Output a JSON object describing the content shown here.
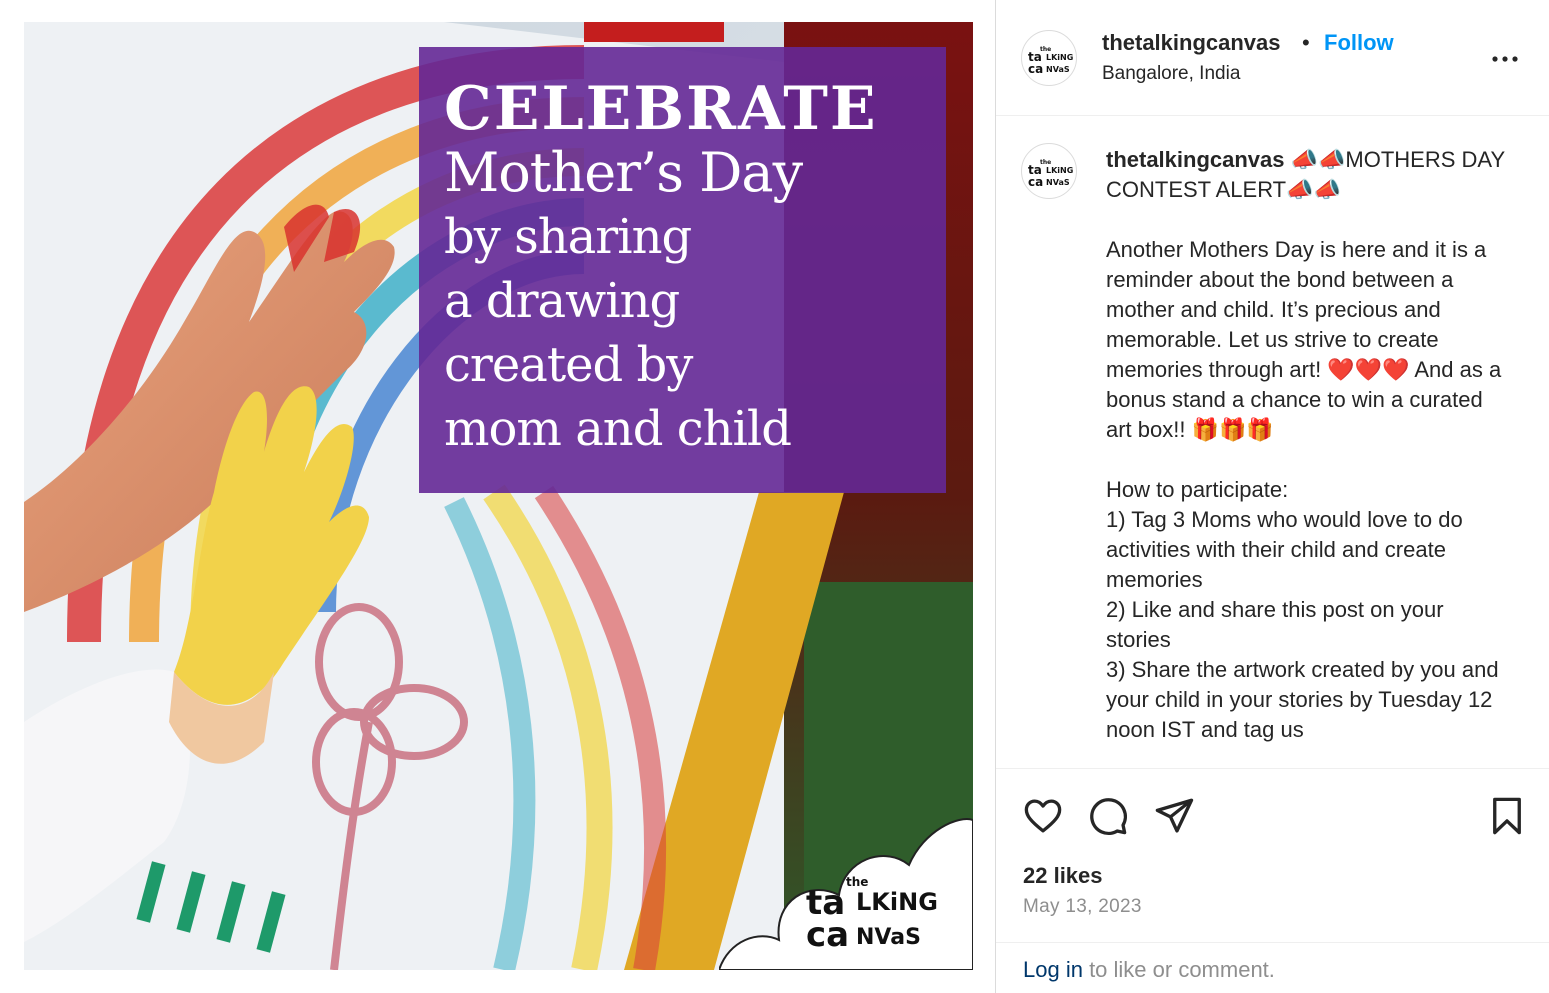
{
  "post": {
    "image": {
      "headline_lines": [
        "CELEBRATE",
        "Mother’s Day",
        "by sharing",
        "a drawing",
        "created by",
        "mom and child"
      ],
      "logo_text": "the talking canvas"
    }
  },
  "header": {
    "username": "thetalkingcanvas",
    "separator": "•",
    "follow_label": "Follow",
    "location": "Bangalore, India"
  },
  "caption": {
    "username": "thetalkingcanvas",
    "text": " 📣📣MOTHERS DAY CONTEST ALERT📣📣\n\nAnother Mothers Day is here and it is a reminder about the bond between a mother and child. It’s precious and memorable. Let us strive to create memories through art! ❤️❤️❤️ And as a bonus stand a chance to win a curated art box!! 🎁🎁🎁\n\nHow to participate:\n1) Tag 3 Moms who would love to do activities with their child and create memories\n2) Like and share this post on your stories\n3) Share the artwork created by you and your child in your stories by Tuesday 12 noon IST and tag us"
  },
  "stats": {
    "likes": "22 likes",
    "date": "May 13, 2023"
  },
  "login": {
    "link": "Log in",
    "rest": " to like or comment."
  },
  "icons": {
    "more": "more-options-icon",
    "like": "heart-icon",
    "comment": "comment-icon",
    "share": "share-icon",
    "save": "bookmark-icon"
  }
}
